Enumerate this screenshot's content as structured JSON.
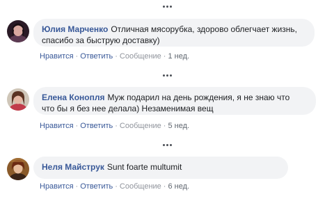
{
  "comments": [
    {
      "author": "Юлия Марченко",
      "text_line1": "Отличная мясорубка, здорово облегчает жизнь,",
      "text_line2": "спасибо за быструю доставку)",
      "actions": {
        "like": "Нравится",
        "reply": "Ответить",
        "message": "Сообщение",
        "time": "1 нед."
      }
    },
    {
      "author": "Елена Конопля",
      "text_line1": "Муж подарил на день рождения, я не знаю что",
      "text_line2": "что бы я без нее делала) Незаменимая вещ",
      "actions": {
        "like": "Нравится",
        "reply": "Ответить",
        "message": "Сообщение",
        "time": "5 нед."
      }
    },
    {
      "author": "Неля Майструк",
      "text_line1": "Sunt foarte multumit",
      "text_line2": "",
      "actions": {
        "like": "Нравится",
        "reply": "Ответить",
        "message": "Сообщение",
        "time": "6 нед."
      }
    }
  ],
  "separator": "·"
}
